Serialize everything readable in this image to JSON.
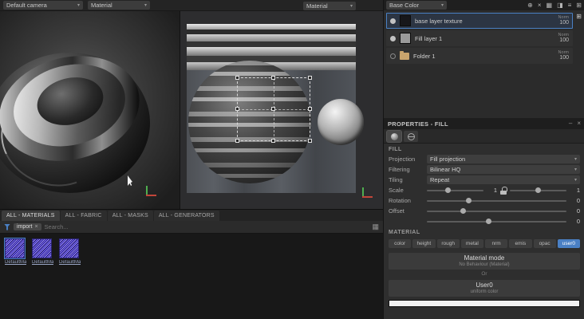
{
  "topbar": {
    "camera": "Default camera",
    "shader": "Material",
    "view_mode": "Material"
  },
  "icons": {
    "chevron": "▾",
    "close": "×",
    "minimize": "–",
    "grid": "▦",
    "dock": "⊞",
    "tool1": "⊕",
    "tool2": "×",
    "tool3": "▦",
    "tool4": "◨",
    "tool5": "≡",
    "tool6": "⊞"
  },
  "layers_panel": {
    "channel_view": "Base Color",
    "items": [
      {
        "name": "base layer texture",
        "blend": "Norm",
        "opacity": "100"
      },
      {
        "name": "Fill layer 1",
        "blend": "Norm",
        "opacity": "100"
      },
      {
        "name": "Folder 1",
        "blend": "Norm",
        "opacity": "100"
      }
    ]
  },
  "properties": {
    "title": "PROPERTIES - FILL",
    "fill_section": "FILL",
    "projection_label": "Projection",
    "projection_value": "Fill projection",
    "filtering_label": "Filtering",
    "filtering_value": "Bilinear HQ",
    "tiling_label": "Tiling",
    "tiling_value": "Repeat",
    "scale_label": "Scale",
    "scale_value_u": "1",
    "scale_value_v": "1",
    "rotation_label": "Rotation",
    "rotation_value": "0",
    "offset_label": "Offset",
    "offset_value_u": "0",
    "offset_value_v": "0",
    "material_section": "MATERIAL",
    "channels": [
      "color",
      "height",
      "rough",
      "metal",
      "nrm",
      "emis",
      "opac",
      "user0"
    ],
    "active_channel": "user0",
    "material_mode": {
      "title": "Material mode",
      "subtitle": "No Behaviour (Material)"
    },
    "divider": "Or",
    "user0": {
      "title": "User0",
      "subtitle": "uniform color"
    },
    "swatch_color": "#f2f2f2",
    "accent_color": "#4a80c4"
  },
  "shelf": {
    "tabs": [
      "ALL - MATERIALS",
      "ALL - FABRIC",
      "ALL - MASKS",
      "ALL - GENERATORS"
    ],
    "active_tab": "ALL - MATERIALS",
    "filter_chip": "import",
    "search_placeholder": "Search...",
    "items": [
      {
        "label": "DefaultMa..."
      },
      {
        "label": "DefaultMat..."
      },
      {
        "label": "DefaultMat..."
      }
    ]
  }
}
